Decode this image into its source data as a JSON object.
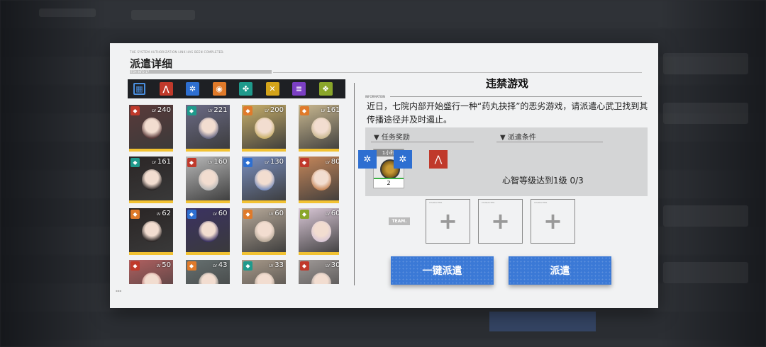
{
  "modal": {
    "title": "派遣详细",
    "system_line": "THE SYSTEM AUTHORIZATION LINK HAS BEEN COMPLETED.",
    "title_code": "ITEM INFO-17"
  },
  "tabs": [
    {
      "name": "all",
      "icon": "grid-icon",
      "color": "#4a8fe0"
    },
    {
      "name": "red",
      "icon": "road-icon",
      "color": "#c0392b"
    },
    {
      "name": "blue",
      "icon": "gear-icon",
      "color": "#2e6fd1"
    },
    {
      "name": "orange",
      "icon": "flame-icon",
      "color": "#e07a2a"
    },
    {
      "name": "teal",
      "icon": "clover-icon",
      "color": "#1f9a8c"
    },
    {
      "name": "yellow",
      "icon": "cross-icon",
      "color": "#d4a41a"
    },
    {
      "name": "purple",
      "icon": "book-icon",
      "color": "#7b3fc4"
    },
    {
      "name": "green",
      "icon": "shield-icon",
      "color": "#8aa62a"
    }
  ],
  "characters": [
    {
      "level": "240",
      "color": "#c0392b",
      "tone": "#5a3a3a"
    },
    {
      "level": "221",
      "color": "#1f9a8c",
      "tone": "#6b6b86"
    },
    {
      "level": "200",
      "color": "#e07a2a",
      "tone": "#c9b06a"
    },
    {
      "level": "161",
      "color": "#e07a2a",
      "tone": "#c9b890"
    },
    {
      "level": "161",
      "color": "#1f9a8c",
      "tone": "#2b2626"
    },
    {
      "level": "160",
      "color": "#c0392b",
      "tone": "#b8b8b8"
    },
    {
      "level": "130",
      "color": "#2e6fd1",
      "tone": "#7a8fbf"
    },
    {
      "level": "80",
      "color": "#c0392b",
      "tone": "#c6875a"
    },
    {
      "level": "62",
      "color": "#e07a2a",
      "tone": "#2a2525"
    },
    {
      "level": "60",
      "color": "#2e6fd1",
      "tone": "#3b3262"
    },
    {
      "level": "60",
      "color": "#e07a2a",
      "tone": "#b8aa9a"
    },
    {
      "level": "60",
      "color": "#8aa62a",
      "tone": "#d9c7d6"
    },
    {
      "level": "50",
      "color": "#c0392b",
      "tone": "#b06060"
    },
    {
      "level": "43",
      "color": "#e07a2a",
      "tone": "#667070"
    },
    {
      "level": "33",
      "color": "#1f9a8c",
      "tone": "#a89a8a"
    },
    {
      "level": "30",
      "color": "#c0392b",
      "tone": "#a09a98"
    }
  ],
  "lv_prefix": "LV",
  "mission": {
    "name": "违禁游戏",
    "info_label": "INFORMATION",
    "description": "近日，七院内部开始盛行一种“药丸抉择”的恶劣游戏，请派遣心武卫找到其传播途径并及时遏止。"
  },
  "rewards": {
    "header": "▼ 任务奖励",
    "time": "1小时",
    "count": "2"
  },
  "conditions": {
    "header": "▼ 派遣条件",
    "icons": [
      {
        "name": "gear-icon",
        "color": "#2e6fd1"
      },
      {
        "name": "gear-icon",
        "color": "#2e6fd1"
      },
      {
        "name": "road-icon",
        "color": "#c0392b"
      }
    ],
    "text": "心智等级达到1级 0/3"
  },
  "team": {
    "label": "TEAM.",
    "slot_tag": "CHARACTER"
  },
  "buttons": {
    "auto_dispatch": "一键派遣",
    "dispatch": "派遣"
  }
}
